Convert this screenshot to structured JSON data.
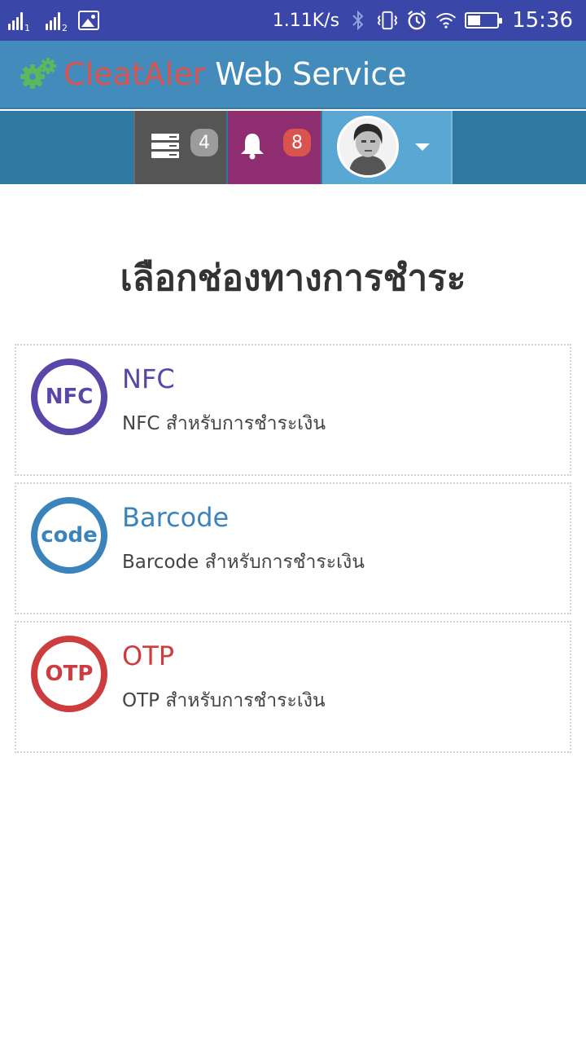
{
  "status_bar": {
    "sim1_label": "1",
    "sim2_label": "2",
    "net_speed": "1.11K/s",
    "time": "15:36",
    "battery_level": 0.45,
    "icons": [
      "signal-sim1-icon",
      "signal-sim2-icon",
      "image-notification-icon",
      "bluetooth-icon",
      "vibrate-icon",
      "alarm-icon",
      "wifi-icon",
      "battery-icon"
    ]
  },
  "header": {
    "brand_red": "CleatAler",
    "brand_white": "Web Service",
    "colors": {
      "bar": "#428bbb",
      "brand_red": "#d9534f",
      "logo_green": "#5cb85c"
    }
  },
  "toolbar": {
    "tasks_badge": "4",
    "notifications_badge": "8",
    "colors": {
      "tasks": "#555555",
      "notifications": "#8e2d6f",
      "user": "#5ba7d3"
    }
  },
  "main": {
    "title": "เลือกช่องทางการชำระ",
    "methods": [
      {
        "icon_text": "NFC",
        "title": "NFC",
        "description": "NFC สำหรับการชำระเงิน",
        "color": "#5a45a8"
      },
      {
        "icon_text": "code",
        "title": "Barcode",
        "description": "Barcode สำหรับการชำระเงิน",
        "color": "#3b84bb"
      },
      {
        "icon_text": "OTP",
        "title": "OTP",
        "description": "OTP สำหรับการชำระเงิน",
        "color": "#cd3c3f"
      }
    ]
  }
}
